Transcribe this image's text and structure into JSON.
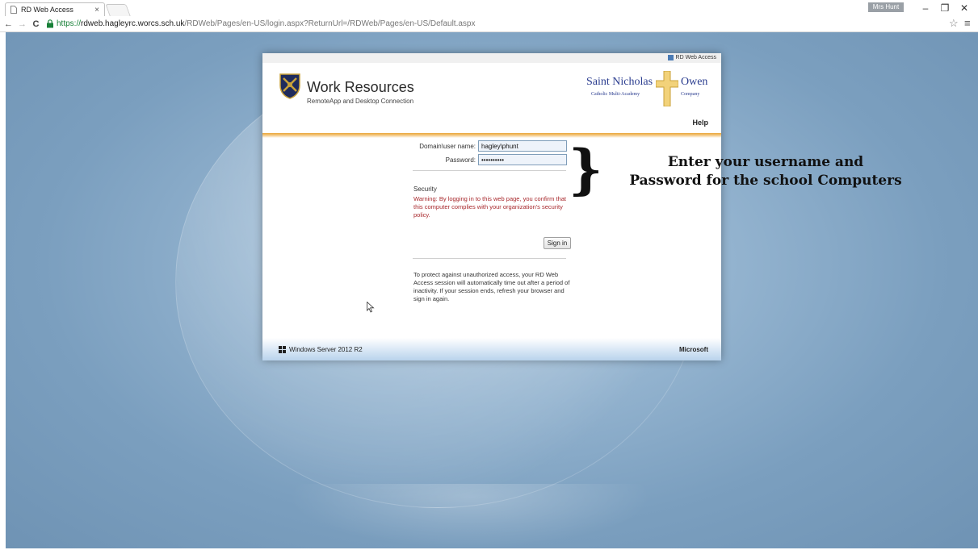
{
  "browser": {
    "tab_title": "RD Web Access",
    "tab_close": "×",
    "profile_label": "Mrs Hunt",
    "window_minimize": "–",
    "window_restore": "❐",
    "window_close": "✕",
    "back": "←",
    "forward": "→",
    "reload": "C",
    "url_scheme": "https://",
    "url_host": "rdweb.hagleyrc.worcs.sch.uk",
    "url_path": "/RDWeb/Pages/en-US/login.aspx?ReturnUrl=/RDWeb/Pages/en-US/Default.aspx",
    "bookmark_icon": "☆",
    "menu_icon": "≡"
  },
  "panel": {
    "top_label": "RD Web Access",
    "title": "Work Resources",
    "subtitle": "RemoteApp and Desktop Connection",
    "school_name_left": "Saint Nicholas",
    "school_name_sub": "Catholic Multi-Academy",
    "school_name_right": "Owen",
    "school_name_right_sub": "Company",
    "help": "Help",
    "login": {
      "username_label": "Domain\\user name:",
      "username_value": "hagley\\phunt",
      "password_label": "Password:",
      "password_value": "••••••••••"
    },
    "security_title": "Security",
    "security_warning": "Warning: By logging in to this web page, you confirm that this computer complies with your organization's security policy.",
    "signin_button": "Sign in",
    "timeout_note": "To protect against unauthorized access, your RD Web Access session will automatically time out after a period of inactivity. If your session ends, refresh your browser and sign in again.",
    "footer_left": "Windows Server 2012 R2",
    "footer_right": "Microsoft"
  },
  "annotation": {
    "brace": "}",
    "line1": "Enter your username and",
    "line2": "Password for the school Computers"
  },
  "colors": {
    "accent_orange": "#e9a53a",
    "warning_red": "#a8282c",
    "background_blue": "#7b9fbf",
    "school_blue": "#2a3c8f"
  }
}
